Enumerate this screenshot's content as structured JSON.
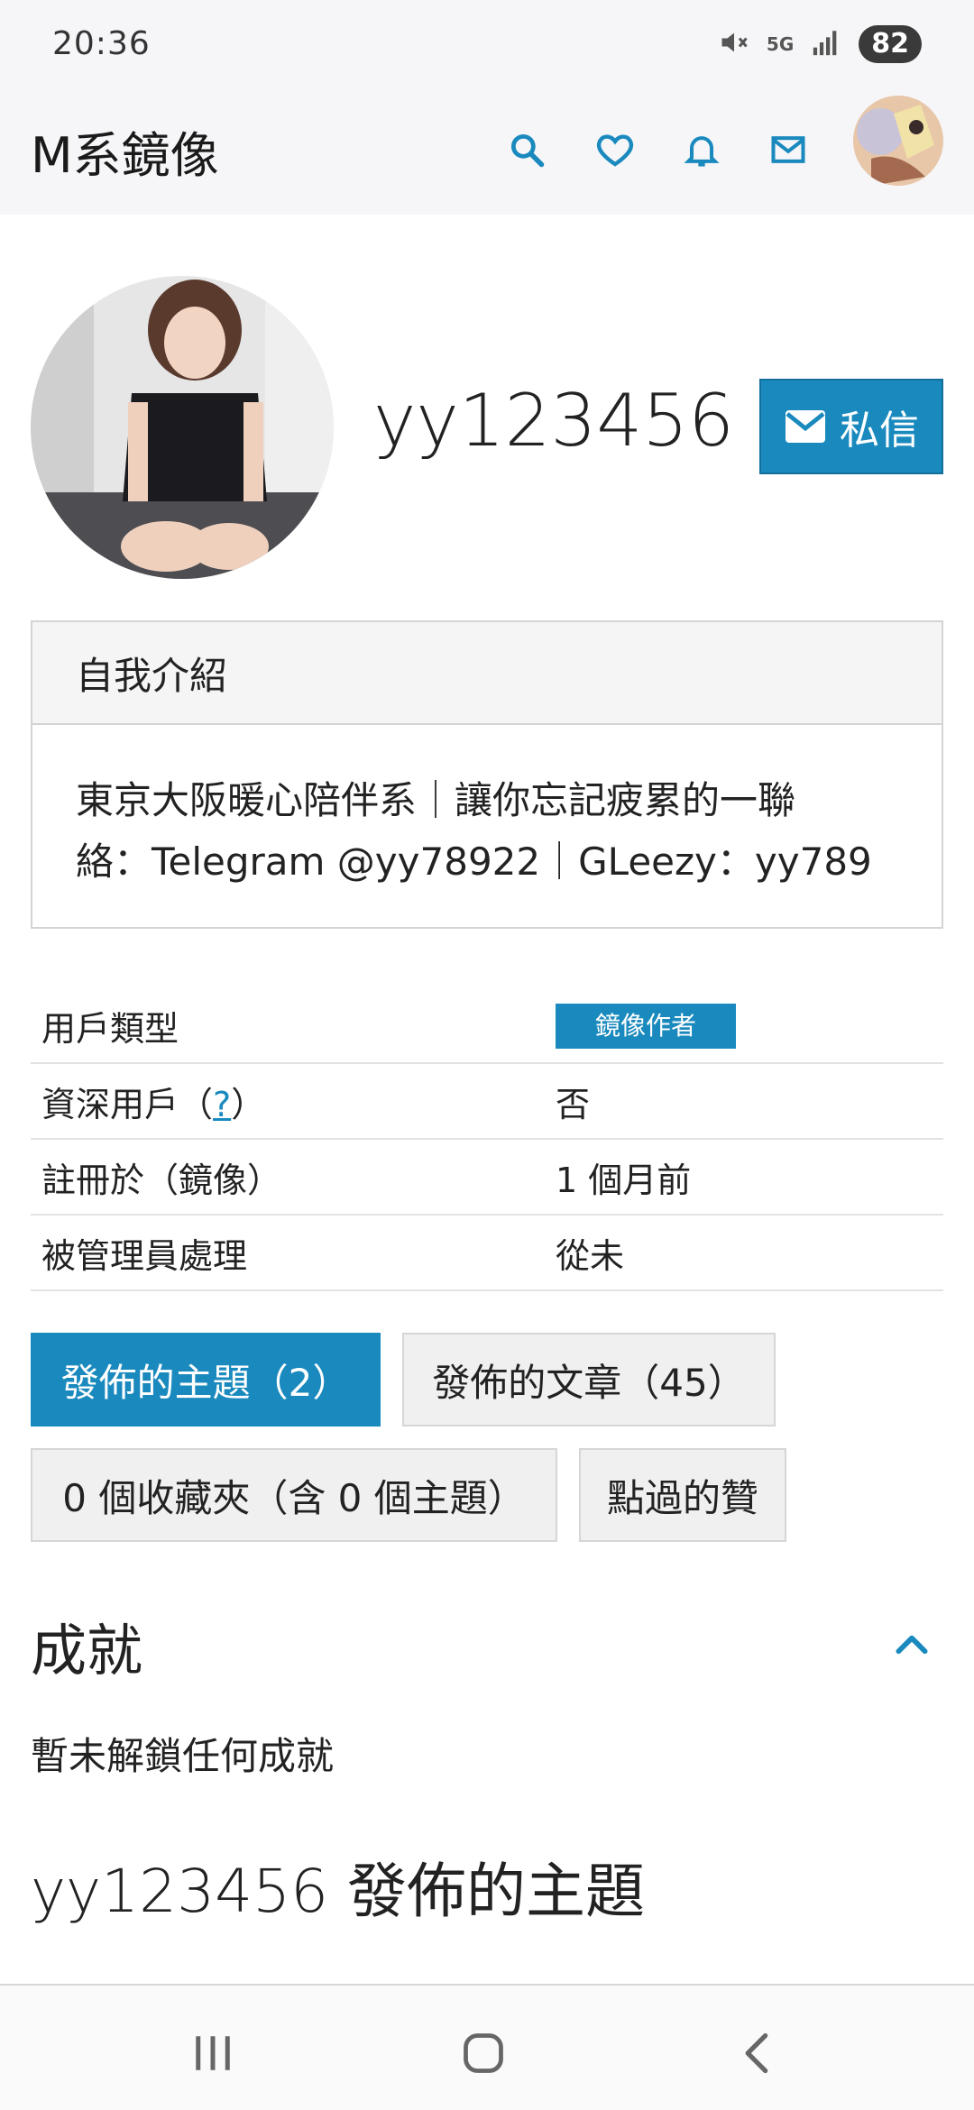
{
  "status_bar": {
    "time": "20:36",
    "battery": "82",
    "network": "5G"
  },
  "header": {
    "site_title": "M系鏡像"
  },
  "profile": {
    "username": "yy123456",
    "pm_button_label": "私信"
  },
  "intro": {
    "heading": "自我介紹",
    "line1": "東京大阪暖心陪伴系｜讓你忘記疲累的一聯",
    "line2": "絡：Telegram @yy78922｜GLeezy：yy789"
  },
  "info": {
    "rows": [
      {
        "label": "用戶類型",
        "value": "鏡像作者"
      },
      {
        "label_prefix": "資深用戶（",
        "label_link": "?",
        "label_suffix": "）",
        "value": "否"
      },
      {
        "label": "註冊於（鏡像）",
        "value": "1 個月前"
      },
      {
        "label": "被管理員處理",
        "value": "從未"
      }
    ]
  },
  "tabs": [
    {
      "label": "發佈的主題（2）",
      "active": true
    },
    {
      "label": "發佈的文章（45）",
      "active": false
    },
    {
      "label": "0 個收藏夾（含 0 個主題）",
      "active": false
    },
    {
      "label": "點過的贊",
      "active": false
    }
  ],
  "achievements": {
    "title": "成就",
    "empty_text": "暫未解鎖任何成就"
  },
  "posts_section": {
    "title": "yy123456 發佈的主題"
  },
  "colors": {
    "accent": "#1a8abe",
    "header_bg": "#f6f6f8"
  },
  "icons": [
    "search-icon",
    "heart-icon",
    "bell-icon",
    "mail-icon",
    "chevron-up-icon",
    "recent-apps-icon",
    "home-icon",
    "back-icon"
  ]
}
